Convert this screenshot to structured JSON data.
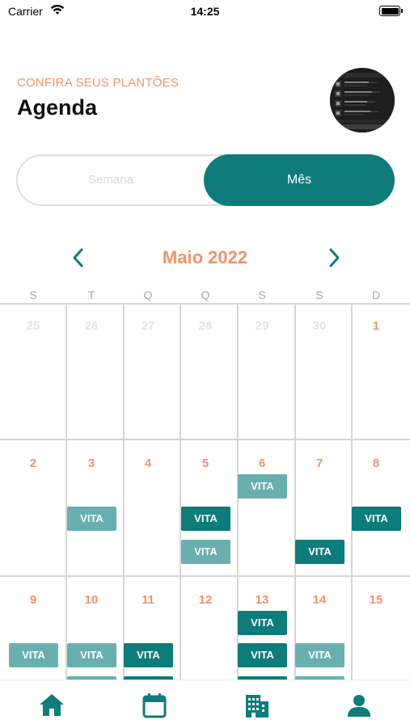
{
  "status_bar": {
    "carrier": "Carrier",
    "time": "14:25"
  },
  "header": {
    "subtitle": "CONFIRA SEUS PLANTÕES",
    "title": "Agenda"
  },
  "view_toggle": {
    "week_label": "Semana",
    "month_label": "Mês",
    "selected": "Mês"
  },
  "calendar": {
    "month_label": "Maio 2022",
    "weekdays": [
      "S",
      "T",
      "Q",
      "Q",
      "S",
      "S",
      "D"
    ],
    "weeks": [
      {
        "days": [
          "25",
          "26",
          "27",
          "28",
          "29",
          "30",
          "1"
        ],
        "muted": [
          true,
          true,
          true,
          true,
          true,
          true,
          false
        ],
        "events": []
      },
      {
        "days": [
          "2",
          "3",
          "4",
          "5",
          "6",
          "7",
          "8"
        ],
        "muted": [
          false,
          false,
          false,
          false,
          false,
          false,
          false
        ],
        "events": [
          {
            "day_index": 4,
            "slot": 0,
            "label": "VITA",
            "tone": "light"
          },
          {
            "day_index": 1,
            "slot": 1,
            "label": "VITA",
            "tone": "light"
          },
          {
            "day_index": 3,
            "slot": 1,
            "label": "VITA",
            "tone": "dark"
          },
          {
            "day_index": 6,
            "slot": 1,
            "label": "VITA",
            "tone": "dark"
          },
          {
            "day_index": 3,
            "slot": 2,
            "label": "VITA",
            "tone": "light"
          },
          {
            "day_index": 5,
            "slot": 2,
            "label": "VITA",
            "tone": "dark"
          }
        ]
      },
      {
        "days": [
          "9",
          "10",
          "11",
          "12",
          "13",
          "14",
          "15"
        ],
        "muted": [
          false,
          false,
          false,
          false,
          false,
          false,
          false
        ],
        "events": [
          {
            "day_index": 4,
            "slot": 0,
            "label": "VITA",
            "tone": "dark"
          },
          {
            "day_index": 0,
            "slot": 1,
            "label": "VITA",
            "tone": "light"
          },
          {
            "day_index": 1,
            "slot": 1,
            "label": "VITA",
            "tone": "light"
          },
          {
            "day_index": 2,
            "slot": 1,
            "label": "VITA",
            "tone": "dark"
          },
          {
            "day_index": 4,
            "slot": 1,
            "label": "VITA",
            "tone": "dark"
          },
          {
            "day_index": 5,
            "slot": 1,
            "label": "VITA",
            "tone": "light"
          },
          {
            "day_index": 1,
            "slot": 2,
            "label": "",
            "tone": "light"
          },
          {
            "day_index": 2,
            "slot": 2,
            "label": "",
            "tone": "dark"
          },
          {
            "day_index": 4,
            "slot": 2,
            "label": "",
            "tone": "dark"
          },
          {
            "day_index": 5,
            "slot": 2,
            "label": "",
            "tone": "light"
          }
        ]
      }
    ]
  },
  "tab_bar": {
    "items": [
      {
        "name": "home-icon",
        "active": true
      },
      {
        "name": "calendar-icon",
        "active": false
      },
      {
        "name": "building-icon",
        "active": false
      },
      {
        "name": "profile-icon",
        "active": false
      }
    ]
  },
  "colors": {
    "accent": "#0e7c7b",
    "accent_light": "#6aafaf",
    "orange": "#f0936a",
    "grid": "#d6d6d6"
  }
}
